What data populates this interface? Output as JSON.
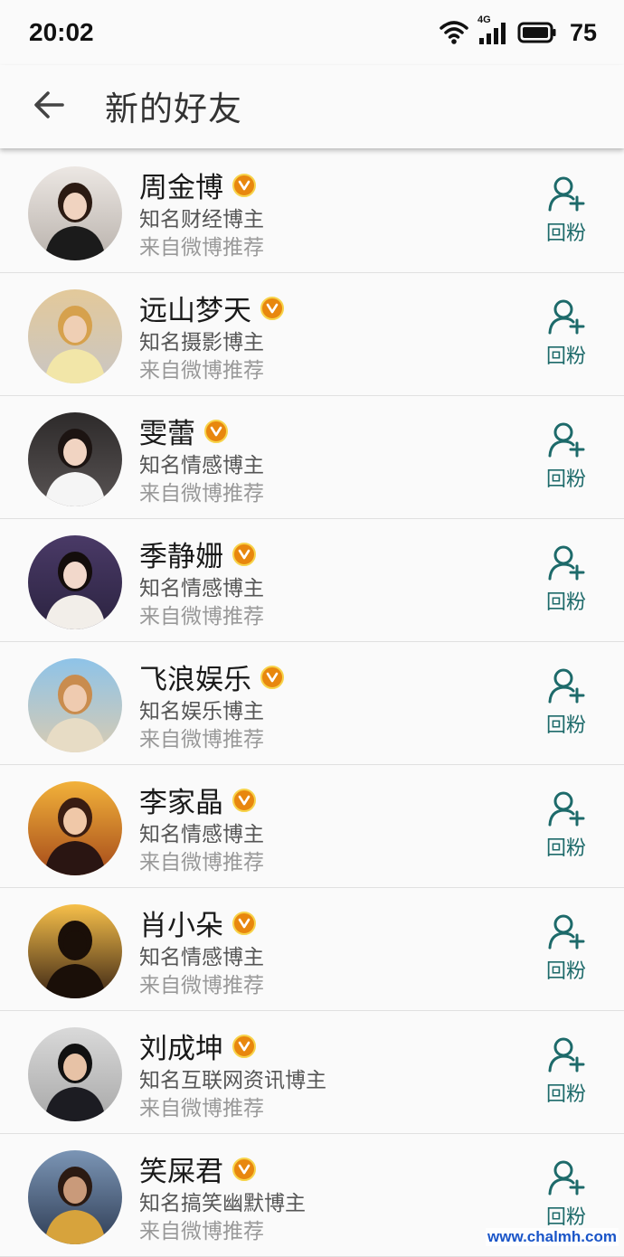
{
  "status_bar": {
    "time": "20:02",
    "network": "4G",
    "battery": "75"
  },
  "header": {
    "title": "新的好友",
    "back_icon": "arrow-left-icon"
  },
  "friends": [
    {
      "name": "周金博",
      "desc": "知名财经博主",
      "source": "来自微博推荐",
      "follow_label": "回粉",
      "verified": true
    },
    {
      "name": "远山梦天",
      "desc": "知名摄影博主",
      "source": "来自微博推荐",
      "follow_label": "回粉",
      "verified": true
    },
    {
      "name": "雯蕾",
      "desc": "知名情感博主",
      "source": "来自微博推荐",
      "follow_label": "回粉",
      "verified": true
    },
    {
      "name": "季静姗",
      "desc": "知名情感博主",
      "source": "来自微博推荐",
      "follow_label": "回粉",
      "verified": true
    },
    {
      "name": "飞浪娱乐",
      "desc": "知名娱乐博主",
      "source": "来自微博推荐",
      "follow_label": "回粉",
      "verified": true
    },
    {
      "name": "李家晶",
      "desc": "知名情感博主",
      "source": "来自微博推荐",
      "follow_label": "回粉",
      "verified": true
    },
    {
      "name": "肖小朵",
      "desc": "知名情感博主",
      "source": "来自微博推荐",
      "follow_label": "回粉",
      "verified": true
    },
    {
      "name": "刘成坤",
      "desc": "知名互联网资讯博主",
      "source": "来自微博推荐",
      "follow_label": "回粉",
      "verified": true
    },
    {
      "name": "笑屎君",
      "desc": "知名搞笑幽默博主",
      "source": "来自微博推荐",
      "follow_label": "回粉",
      "verified": true
    }
  ],
  "watermark": "www.chalmh.com",
  "colors": {
    "accent": "#1d6a6a",
    "badge": "#e8870e"
  }
}
